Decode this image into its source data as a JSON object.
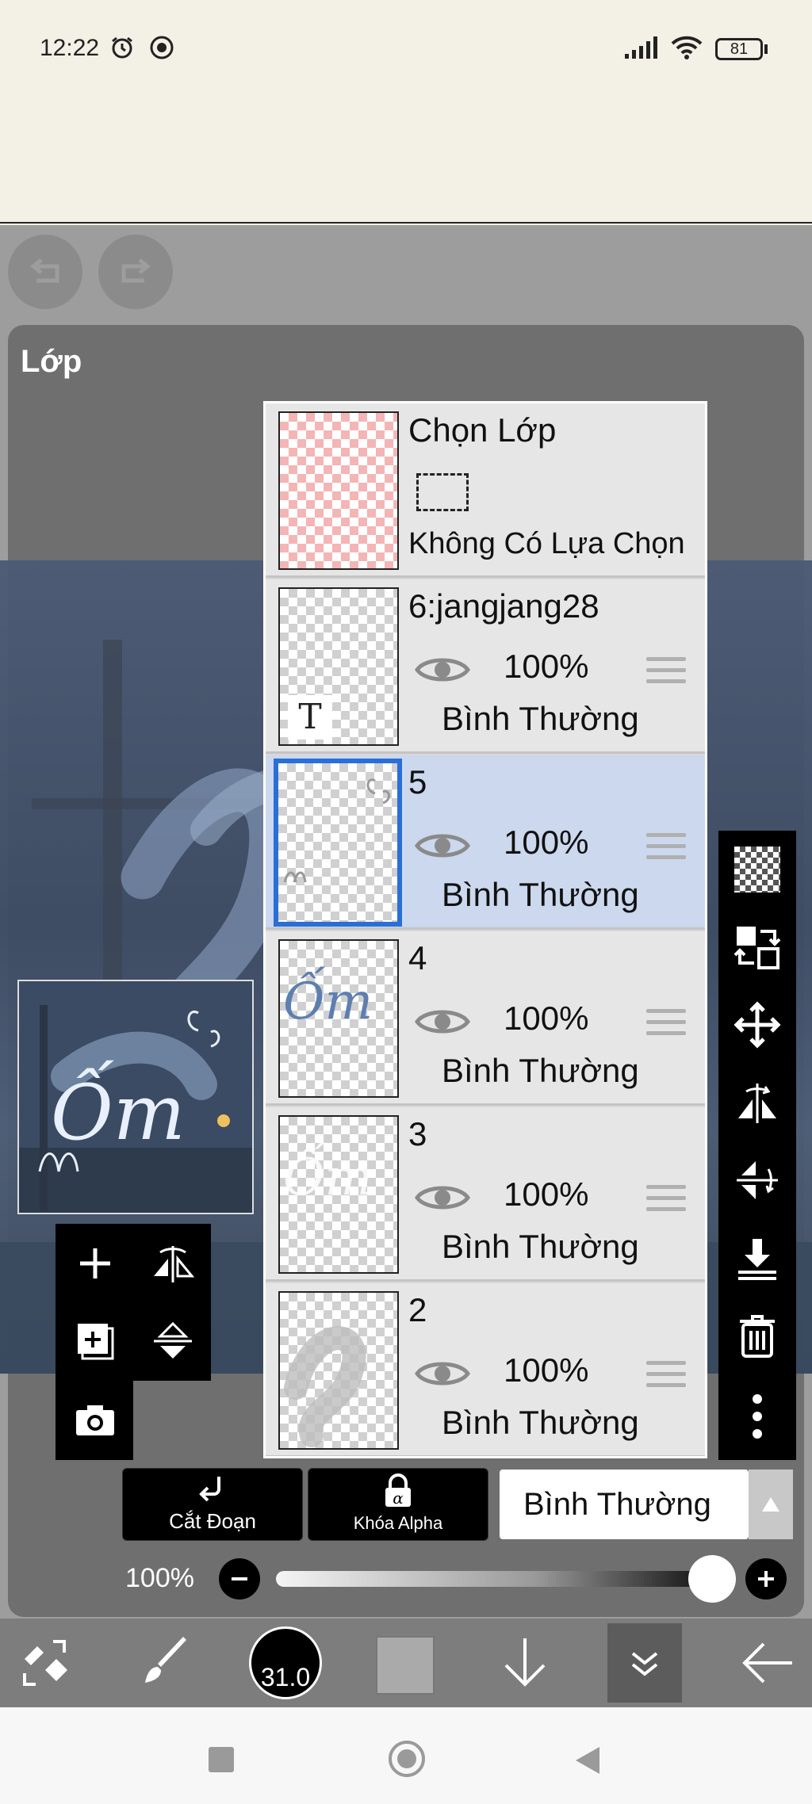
{
  "status": {
    "time": "12:22",
    "battery": "81"
  },
  "panel": {
    "title": "Lớp"
  },
  "selection_layer": {
    "title": "Chọn Lớp",
    "status": "Không Có Lựa Chọn"
  },
  "layers": [
    {
      "name": "6:jangjang28",
      "opacity": "100%",
      "blend": "Bình Thường",
      "thumb_glyph": "T"
    },
    {
      "name": "5",
      "opacity": "100%",
      "blend": "Bình Thường"
    },
    {
      "name": "4",
      "opacity": "100%",
      "blend": "Bình Thường"
    },
    {
      "name": "3",
      "opacity": "100%",
      "blend": "Bình Thường"
    },
    {
      "name": "2",
      "opacity": "100%",
      "blend": "Bình Thường"
    }
  ],
  "selected_layer": "5",
  "controls": {
    "clip_label": "Cắt Đoạn",
    "alpha_lock_label": "Khóa Alpha",
    "blend_mode": "Bình Thường",
    "opacity_label": "100%",
    "opacity_value": 100
  },
  "toolbar": {
    "brush_size": "31.0"
  },
  "canvas_text": "Ốm",
  "colors": {
    "selection_blue": "#2a6fd6",
    "selected_row": "#cbd8ee",
    "panel": "#6f6f6f"
  }
}
